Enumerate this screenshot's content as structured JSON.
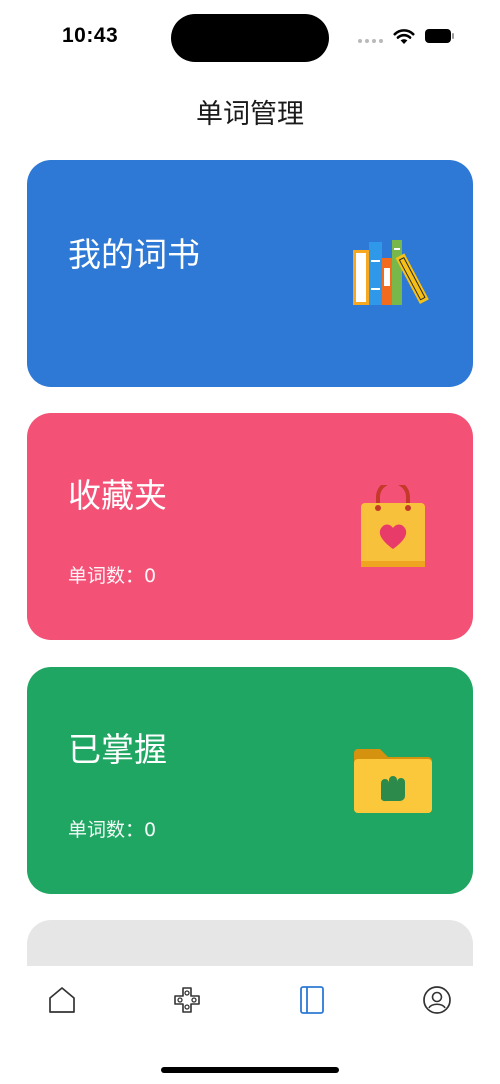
{
  "status_bar": {
    "time": "10:43"
  },
  "nav": {
    "title": "单词管理"
  },
  "cards": [
    {
      "title": "我的词书",
      "color": "#2e79d5",
      "icon": "books-icon"
    },
    {
      "title": "收藏夹",
      "subtitle": "单词数：0",
      "color": "#f45176",
      "icon": "heart-bag-icon"
    },
    {
      "title": "已掌握",
      "subtitle": "单词数：0",
      "color": "#20a663",
      "icon": "fist-folder-icon"
    },
    {
      "color": "#e6e6e6"
    }
  ],
  "tab_bar": {
    "active_index": 2,
    "active_color": "#2e79d5",
    "items": [
      {
        "icon": "home-icon"
      },
      {
        "icon": "gamepad-icon"
      },
      {
        "icon": "book-icon"
      },
      {
        "icon": "profile-icon"
      }
    ]
  }
}
